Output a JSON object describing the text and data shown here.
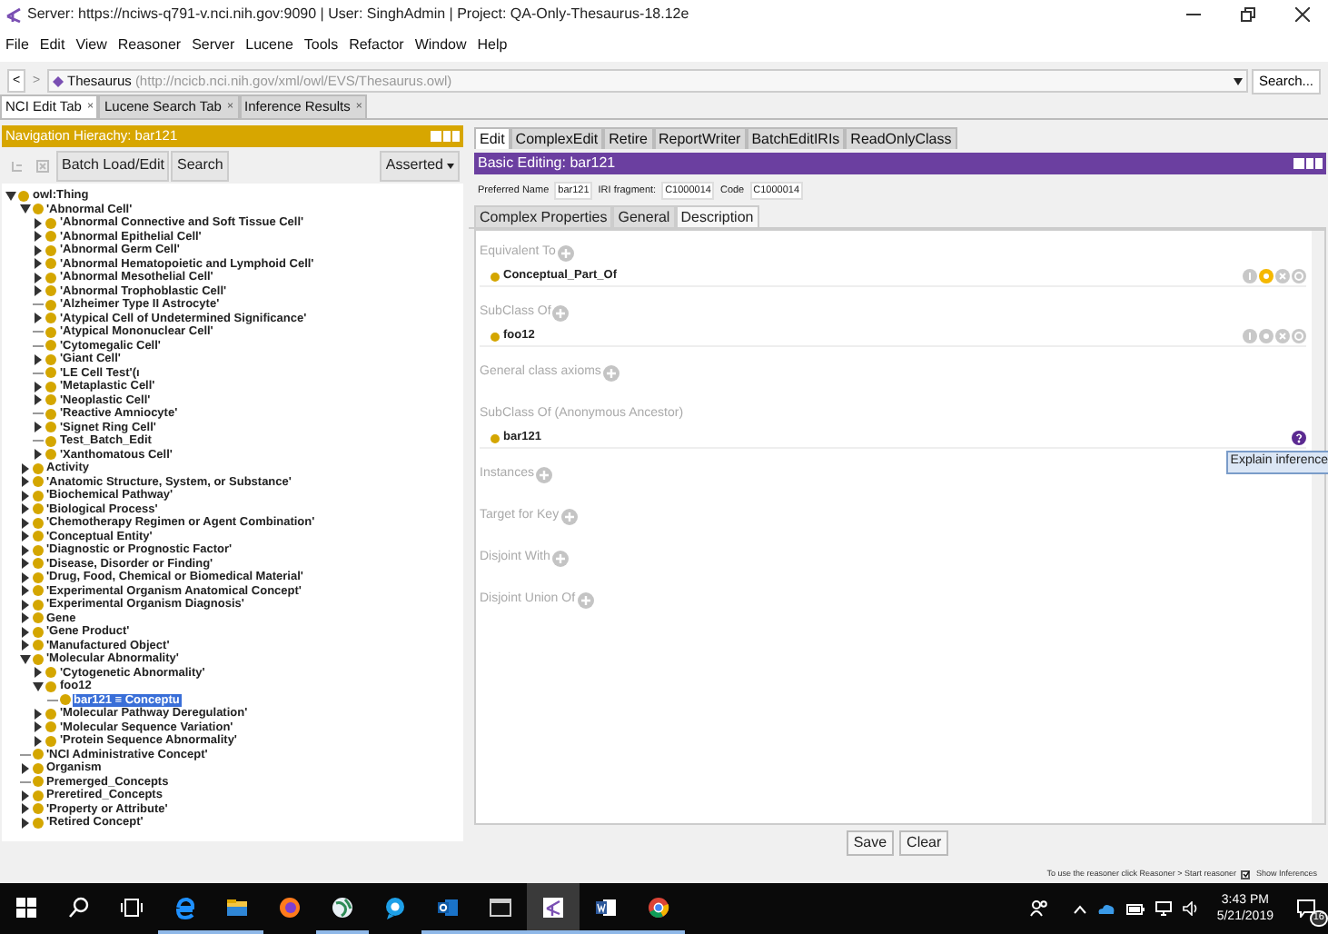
{
  "window": {
    "title": "Server: https://nciws-q791-v.nci.nih.gov:9090 | User: SinghAdmin | Project: QA-Only-Thesaurus-18.12e"
  },
  "menu": [
    "File",
    "Edit",
    "View",
    "Reasoner",
    "Server",
    "Lucene",
    "Tools",
    "Refactor",
    "Window",
    "Help"
  ],
  "address_bar": {
    "back": "<",
    "forward": ">",
    "forward_disabled": true,
    "ontology": "Thesaurus",
    "iri": "(http://ncicb.nci.nih.gov/xml/owl/EVS/Thesaurus.owl)",
    "search_button": "Search..."
  },
  "tabs": [
    {
      "label": "NCI Edit Tab",
      "selected": true,
      "close": "×"
    },
    {
      "label": "Lucene Search Tab",
      "selected": false,
      "close": "×"
    },
    {
      "label": "Inference Results",
      "selected": false,
      "close": "×"
    }
  ],
  "navigation": {
    "title": "Navigation Hierachy: bar121",
    "buttons": [
      "Batch Load/Edit",
      "Search"
    ],
    "mode": "Asserted",
    "tree": [
      {
        "label": "owl:Thing",
        "kind": "branch",
        "expanded": true,
        "selected": false,
        "children": [
          {
            "label": "'Abnormal Cell'",
            "kind": "branch",
            "expanded": true,
            "selected": false,
            "children": [
              {
                "label": "'Abnormal Connective and Soft Tissue Cell'",
                "kind": "branch",
                "expanded": false,
                "selected": false
              },
              {
                "label": "'Abnormal Epithelial Cell'",
                "kind": "branch",
                "expanded": false,
                "selected": false
              },
              {
                "label": "'Abnormal Germ Cell'",
                "kind": "branch",
                "expanded": false,
                "selected": false
              },
              {
                "label": "'Abnormal Hematopoietic and Lymphoid Cell'",
                "kind": "branch",
                "expanded": false,
                "selected": false
              },
              {
                "label": "'Abnormal Mesothelial Cell'",
                "kind": "branch",
                "expanded": false,
                "selected": false
              },
              {
                "label": "'Abnormal Trophoblastic Cell'",
                "kind": "branch",
                "expanded": false,
                "selected": false
              },
              {
                "label": "'Alzheimer Type II Astrocyte'",
                "kind": "leaf",
                "selected": false
              },
              {
                "label": "'Atypical Cell of Undetermined Significance'",
                "kind": "branch",
                "expanded": false,
                "selected": false
              },
              {
                "label": "'Atypical Mononuclear Cell'",
                "kind": "leaf",
                "selected": false
              },
              {
                "label": "'Cytomegalic Cell'",
                "kind": "leaf",
                "selected": false
              },
              {
                "label": "'Giant Cell'",
                "kind": "branch",
                "expanded": false,
                "selected": false
              },
              {
                "label": "'LE Cell Test'(ı",
                "kind": "leaf",
                "selected": false
              },
              {
                "label": "'Metaplastic Cell'",
                "kind": "branch",
                "expanded": false,
                "selected": false
              },
              {
                "label": "'Neoplastic Cell'",
                "kind": "branch",
                "expanded": false,
                "selected": false
              },
              {
                "label": "'Reactive Amniocyte'",
                "kind": "leaf",
                "selected": false
              },
              {
                "label": "'Signet Ring Cell'",
                "kind": "branch",
                "expanded": false,
                "selected": false
              },
              {
                "label": "Test_Batch_Edit",
                "kind": "leaf",
                "selected": false
              },
              {
                "label": "'Xanthomatous Cell'",
                "kind": "branch",
                "expanded": false,
                "selected": false
              }
            ]
          },
          {
            "label": "Activity",
            "kind": "branch",
            "expanded": false,
            "selected": false
          },
          {
            "label": "'Anatomic Structure, System, or Substance'",
            "kind": "branch",
            "expanded": false,
            "selected": false
          },
          {
            "label": "'Biochemical Pathway'",
            "kind": "branch",
            "expanded": false,
            "selected": false
          },
          {
            "label": "'Biological Process'",
            "kind": "branch",
            "expanded": false,
            "selected": false
          },
          {
            "label": "'Chemotherapy Regimen or Agent Combination'",
            "kind": "branch",
            "expanded": false,
            "selected": false
          },
          {
            "label": "'Conceptual Entity'",
            "kind": "branch",
            "expanded": false,
            "selected": false
          },
          {
            "label": "'Diagnostic or Prognostic Factor'",
            "kind": "branch",
            "expanded": false,
            "selected": false
          },
          {
            "label": "'Disease, Disorder or Finding'",
            "kind": "branch",
            "expanded": false,
            "selected": false
          },
          {
            "label": "'Drug, Food, Chemical or Biomedical Material'",
            "kind": "branch",
            "expanded": false,
            "selected": false
          },
          {
            "label": "'Experimental Organism Anatomical Concept'",
            "kind": "branch",
            "expanded": false,
            "selected": false
          },
          {
            "label": "'Experimental Organism Diagnosis'",
            "kind": "branch",
            "expanded": false,
            "selected": false
          },
          {
            "label": "Gene",
            "kind": "branch",
            "expanded": false,
            "selected": false
          },
          {
            "label": "'Gene Product'",
            "kind": "branch",
            "expanded": false,
            "selected": false
          },
          {
            "label": "'Manufactured Object'",
            "kind": "branch",
            "expanded": false,
            "selected": false
          },
          {
            "label": "'Molecular Abnormality'",
            "kind": "branch",
            "expanded": true,
            "selected": false,
            "children": [
              {
                "label": "'Cytogenetic Abnormality'",
                "kind": "branch",
                "expanded": false,
                "selected": false
              },
              {
                "label": "foo12",
                "kind": "branch",
                "expanded": true,
                "selected": false,
                "children": [
                  {
                    "label": "bar121 ≡ Conceptu",
                    "kind": "leaf",
                    "selected": true
                  }
                ]
              },
              {
                "label": "'Molecular Pathway Deregulation'",
                "kind": "branch",
                "expanded": false,
                "selected": false
              },
              {
                "label": "'Molecular Sequence Variation'",
                "kind": "branch",
                "expanded": false,
                "selected": false
              },
              {
                "label": "'Protein Sequence Abnormality'",
                "kind": "branch",
                "expanded": false,
                "selected": false
              }
            ]
          },
          {
            "label": "'NCI Administrative Concept'",
            "kind": "leaf",
            "selected": false
          },
          {
            "label": "Organism",
            "kind": "branch",
            "expanded": false,
            "selected": false
          },
          {
            "label": "Premerged_Concepts",
            "kind": "leaf",
            "selected": false
          },
          {
            "label": "Preretired_Concepts",
            "kind": "branch",
            "expanded": false,
            "selected": false
          },
          {
            "label": "'Property or Attribute'",
            "kind": "branch",
            "expanded": false,
            "selected": false
          },
          {
            "label": "'Retired Concept'",
            "kind": "branch",
            "expanded": false,
            "selected": false
          }
        ]
      }
    ]
  },
  "editor": {
    "tabs": [
      {
        "label": "Edit",
        "selected": true
      },
      {
        "label": "ComplexEdit",
        "selected": false
      },
      {
        "label": "Retire",
        "selected": false
      },
      {
        "label": "ReportWriter",
        "selected": false
      },
      {
        "label": "BatchEditIRIs",
        "selected": false
      },
      {
        "label": "ReadOnlyClass",
        "selected": false
      }
    ],
    "title": "Basic Editing: bar121",
    "fields": [
      {
        "label": "Preferred Name",
        "value": "bar121"
      },
      {
        "label": "IRI fragment:",
        "value": "C1000014"
      },
      {
        "label": "Code",
        "value": "C1000014"
      }
    ],
    "subtabs": [
      {
        "label": "Complex Properties",
        "selected": false
      },
      {
        "label": "General",
        "selected": false
      },
      {
        "label": "Description",
        "selected": true
      }
    ],
    "sections": [
      {
        "label": "Equivalent To",
        "items": [
          {
            "label": "Conceptual_Part_Of",
            "kind": "asserted",
            "hovered": true
          }
        ]
      },
      {
        "label": "SubClass Of",
        "items": [
          {
            "label": "foo12",
            "kind": "asserted",
            "hovered": false
          }
        ]
      },
      {
        "label": "General class axioms"
      },
      {
        "label": "SubClass Of (Anonymous Ancestor)",
        "items": [
          {
            "label": "bar121",
            "kind": "inferred",
            "tooltip": "Explain inference"
          }
        ]
      },
      {
        "label": "Instances"
      },
      {
        "label": "Target for Key"
      },
      {
        "label": "Disjoint With"
      },
      {
        "label": "Disjoint Union Of"
      }
    ],
    "buttons": [
      "Save",
      "Clear"
    ]
  },
  "status_bar": {
    "hint": "To use the reasoner click Reasoner > Start reasoner",
    "show_inferences": {
      "label": "Show Inferences",
      "checked": true
    }
  },
  "taskbar": {
    "apps": [
      {
        "kind": "start",
        "running": false,
        "active": false
      },
      {
        "kind": "search",
        "running": false,
        "active": false
      },
      {
        "kind": "taskview",
        "running": false,
        "active": false
      },
      {
        "kind": "edge",
        "running": true,
        "active": false
      },
      {
        "kind": "folder",
        "running": true,
        "active": false
      },
      {
        "kind": "firefox",
        "running": false,
        "active": false
      },
      {
        "kind": "globe",
        "running": true,
        "active": false
      },
      {
        "kind": "chat",
        "running": false,
        "active": false
      },
      {
        "kind": "mail",
        "running": true,
        "active": false
      },
      {
        "kind": "console",
        "running": true,
        "active": false
      },
      {
        "kind": "protege",
        "running": true,
        "active": true
      },
      {
        "kind": "word",
        "running": true,
        "active": false
      },
      {
        "kind": "chrome",
        "running": true,
        "active": false
      }
    ],
    "time": "3:43 PM",
    "date": "5/21/2019",
    "notifications": "16"
  }
}
